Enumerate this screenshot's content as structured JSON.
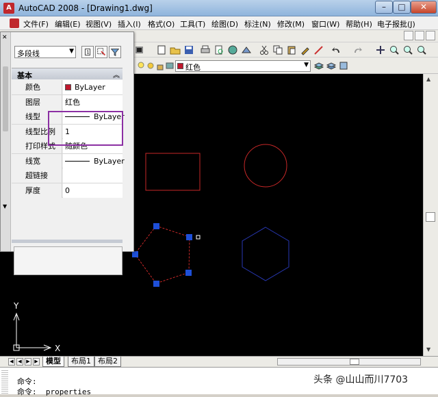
{
  "window": {
    "title": "AutoCAD 2008 - [Drawing1.dwg]",
    "min_glyph": "–",
    "max_glyph": "□",
    "close_glyph": "✕"
  },
  "menu": {
    "items": [
      "文件(F)",
      "编辑(E)",
      "视图(V)",
      "插入(I)",
      "格式(O)",
      "工具(T)",
      "绘图(D)",
      "标注(N)",
      "修改(M)",
      "窗口(W)",
      "帮助(H)",
      "电子报批(J)"
    ]
  },
  "layer_toolbar": {
    "current_layer": "红色",
    "layer_color": "#c0182d"
  },
  "properties_palette": {
    "selection": "多段线",
    "category": "基本",
    "rows": [
      {
        "name": "颜色",
        "value": "ByLayer",
        "kind": "color"
      },
      {
        "name": "图层",
        "value": "红色",
        "kind": "text"
      },
      {
        "name": "线型",
        "value": "ByLayer",
        "kind": "line"
      },
      {
        "name": "线型比例",
        "value": "1",
        "kind": "text"
      },
      {
        "name": "打印样式",
        "value": "随颜色",
        "kind": "text"
      },
      {
        "name": "线宽",
        "value": "ByLayer",
        "kind": "line"
      },
      {
        "name": "超链接",
        "value": "",
        "kind": "text"
      },
      {
        "name": "厚度",
        "value": "0",
        "kind": "text"
      }
    ]
  },
  "canvas": {
    "background": "#000000",
    "ucs_x_label": "X",
    "ucs_y_label": "Y",
    "shapes": [
      {
        "type": "rectangle",
        "color": "#c82828"
      },
      {
        "type": "circle",
        "color": "#c82828"
      },
      {
        "type": "pentagon",
        "color": "#c82828",
        "selected": true
      },
      {
        "type": "hexagon",
        "color": "#2838b4"
      }
    ],
    "grip_color": "#1e4fd8"
  },
  "layout_tabs": [
    "模型",
    "布局1",
    "布局2"
  ],
  "active_tab": "模型",
  "command_line": {
    "lines": [
      "命令:",
      "命令:  properties"
    ]
  },
  "watermark": "头条 @山山而川7703"
}
